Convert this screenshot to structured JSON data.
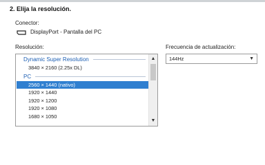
{
  "section": {
    "title": "2. Elija la resolución."
  },
  "connector": {
    "label": "Conector:",
    "icon": "displayport-icon",
    "value": "DisplayPort - Pantalla del PC"
  },
  "resolution": {
    "label": "Resolución:",
    "groups": [
      {
        "name": "Dynamic Super Resolution",
        "items": [
          "3840 × 2160 (2.25x DL)"
        ]
      },
      {
        "name": "PC",
        "items": [
          "2560 × 1440 (nativo)",
          "1920 × 1440",
          "1920 × 1200",
          "1920 × 1080",
          "1680 × 1050"
        ]
      }
    ],
    "selected": "2560 × 1440 (nativo)"
  },
  "refresh": {
    "label": "Frecuencia de actualización:",
    "value": "144Hz"
  },
  "colors": {
    "accent": "#2f7fd0",
    "group_header": "#1d5fb3"
  }
}
